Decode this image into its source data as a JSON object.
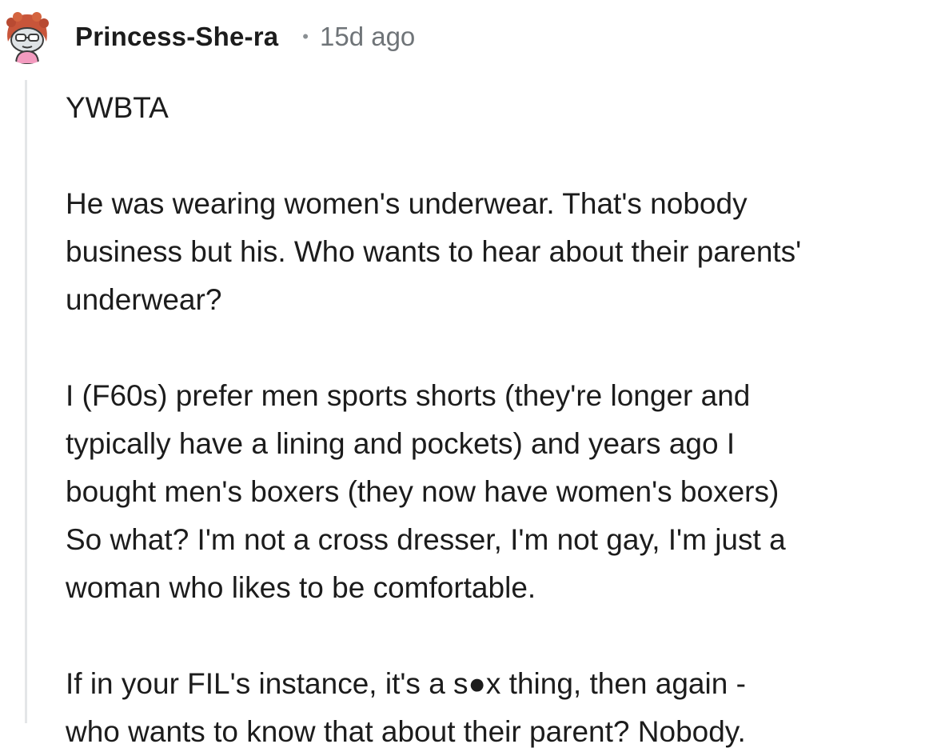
{
  "comment": {
    "author": "Princess-She-ra",
    "separator": "•",
    "time_ago": "15d ago",
    "paragraphs": [
      "YWBTA",
      "He was wearing women's underwear. That's nobody\nbusiness but his. Who wants to hear about their parents'\nunderwear?",
      "I (F60s) prefer men sports shorts (they're longer and\ntypically have a lining and pockets) and years ago I\nbought men's boxers (they now have women's boxers)\nSo what? I'm not a cross dresser, I'm not gay, I'm just a\nwoman who likes to be comfortable.",
      "If in your FIL's instance, it's a s●x thing, then again -\nwho wants to know that about their parent? Nobody."
    ]
  },
  "avatar": {
    "icon": "snoo-avatar-icon",
    "colors": {
      "hair": "#c8553a",
      "skin": "#dfe3e6",
      "shirt": "#f39bbf"
    }
  },
  "colors": {
    "text": "#1c1c1c",
    "meta": "#6f7478",
    "thread_line": "#e4e6e8"
  }
}
